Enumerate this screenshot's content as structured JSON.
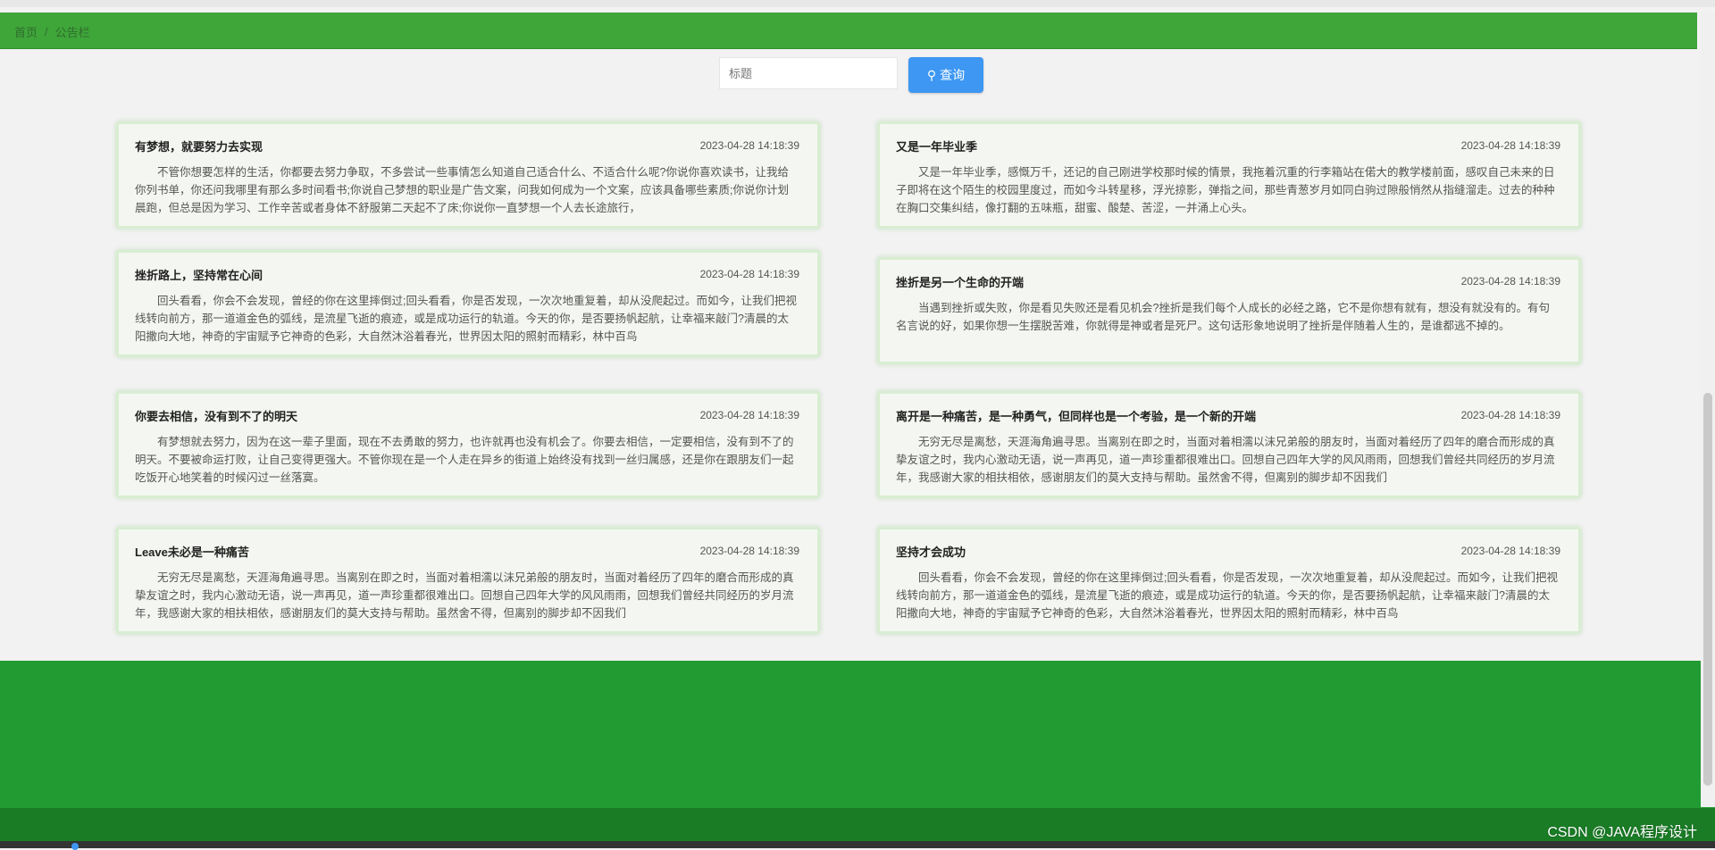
{
  "breadcrumb": {
    "home": "首页",
    "separator": "/",
    "current": "公告栏"
  },
  "search": {
    "placeholder": "标题",
    "button_label": "查询"
  },
  "cards": [
    {
      "title": "有梦想，就要努力去实现",
      "time": "2023-04-28 14:18:39",
      "content": "不管你想要怎样的生活，你都要去努力争取，不多尝试一些事情怎么知道自己适合什么、不适合什么呢?你说你喜欢读书，让我给你列书单，你还问我哪里有那么多时间看书;你说自己梦想的职业是广告文案，问我如何成为一个文案，应该具备哪些素质;你说你计划晨跑，但总是因为学习、工作辛苦或者身体不舒服第二天起不了床;你说你一直梦想一个人去长途旅行，"
    },
    {
      "title": "又是一年毕业季",
      "time": "2023-04-28 14:18:39",
      "content": "又是一年毕业季，感慨万千，还记的自己刚进学校那时候的情景，我拖着沉重的行李箱站在偌大的教学楼前面，感叹自己未来的日子即将在这个陌生的校园里度过，而如今斗转星移，浮光掠影，弹指之间，那些青葱岁月如同白驹过隙般悄然从指缝溜走。过去的种种在胸口交集纠结，像打翻的五味瓶，甜蜜、酸楚、苦涩，一并涌上心头。"
    },
    {
      "title": "挫折路上，坚持常在心间",
      "time": "2023-04-28 14:18:39",
      "content": "回头看看，你会不会发现，曾经的你在这里摔倒过;回头看看，你是否发现，一次次地重复着，却从没爬起过。而如今，让我们把视线转向前方，那一道道金色的弧线，是流星飞逝的痕迹，或是成功运行的轨道。今天的你，是否要扬帆起航，让幸福来敲门?清晨的太阳撒向大地，神奇的宇宙赋予它神奇的色彩，大自然沐浴着春光，世界因太阳的照射而精彩，林中百鸟"
    },
    {
      "title": "挫折是另一个生命的开端",
      "time": "2023-04-28 14:18:39",
      "content": "当遇到挫折或失败，你是看见失败还是看见机会?挫折是我们每个人成长的必经之路，它不是你想有就有，想没有就没有的。有句名言说的好，如果你想一生摆脱苦难，你就得是神或者是死尸。这句话形象地说明了挫折是伴随着人生的，是谁都逃不掉的。"
    },
    {
      "title": "你要去相信，没有到不了的明天",
      "time": "2023-04-28 14:18:39",
      "content": "有梦想就去努力，因为在这一辈子里面，现在不去勇敢的努力，也许就再也没有机会了。你要去相信，一定要相信，没有到不了的明天。不要被命运打败，让自己变得更强大。不管你现在是一个人走在异乡的街道上始终没有找到一丝归属感，还是你在跟朋友们一起吃饭开心地笑着的时候闪过一丝落寞。"
    },
    {
      "title": "离开是一种痛苦，是一种勇气，但同样也是一个考验，是一个新的开端",
      "time": "2023-04-28 14:18:39",
      "content": "无穷无尽是离愁，天涯海角遍寻思。当离别在即之时，当面对着相濡以沫兄弟般的朋友时，当面对着经历了四年的磨合而形成的真挚友谊之时，我内心激动无语，说一声再见，道一声珍重都很难出口。回想自己四年大学的风风雨雨，回想我们曾经共同经历的岁月流年，我感谢大家的相扶相依，感谢朋友们的莫大支持与帮助。虽然舍不得，但离别的脚步却不因我们"
    },
    {
      "title": "Leave未必是一种痛苦",
      "time": "2023-04-28 14:18:39",
      "content": "无穷无尽是离愁，天涯海角遍寻思。当离别在即之时，当面对着相濡以沫兄弟般的朋友时，当面对着经历了四年的磨合而形成的真挚友谊之时，我内心激动无语，说一声再见，道一声珍重都很难出口。回想自己四年大学的风风雨雨，回想我们曾经共同经历的岁月流年，我感谢大家的相扶相依，感谢朋友们的莫大支持与帮助。虽然舍不得，但离别的脚步却不因我们"
    },
    {
      "title": "坚持才会成功",
      "time": "2023-04-28 14:18:39",
      "content": "回头看看，你会不会发现，曾经的你在这里摔倒过;回头看看，你是否发现，一次次地重复着，却从没爬起过。而如今，让我们把视线转向前方，那一道道金色的弧线，是流星飞逝的痕迹，或是成功运行的轨道。今天的你，是否要扬帆起航，让幸福来敲门?清晨的太阳撒向大地，神奇的宇宙赋予它神奇的色彩，大自然沐浴着春光，世界因太阳的照射而精彩，林中百鸟"
    }
  ],
  "watermark": "CSDN @JAVA程序设计",
  "colors": {
    "header": "#3fa63a",
    "footer": "#229b32",
    "button": "#3d97f3",
    "card_border": "#d9edd2"
  }
}
